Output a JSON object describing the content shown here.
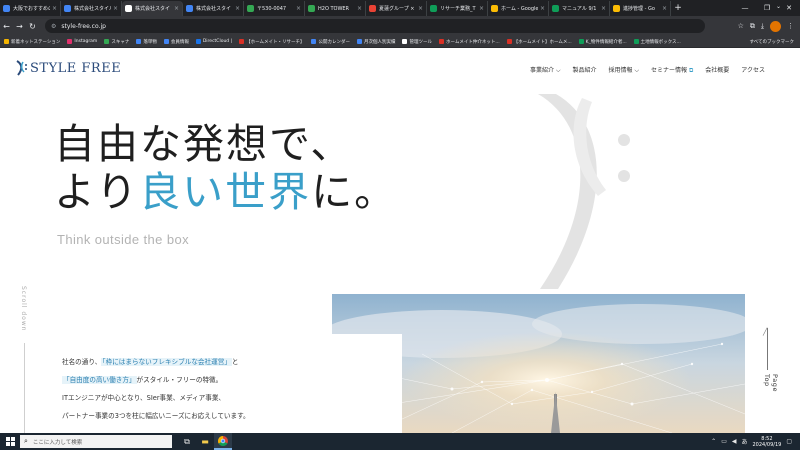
{
  "browser": {
    "tabs": [
      {
        "label": "大阪でおすすめの",
        "color": "#4285f4"
      },
      {
        "label": "株式会社スタイル",
        "color": "#4285f4"
      },
      {
        "label": "株式会社スタイ",
        "color": "#ffffff",
        "active": true
      },
      {
        "label": "株式会社スタイ",
        "color": "#4285f4"
      },
      {
        "label": "〒530-0047",
        "color": "#34a853"
      },
      {
        "label": "H2O TOWER",
        "color": "#34a853"
      },
      {
        "label": "夏蓮グループ ×",
        "color": "#ea4335"
      },
      {
        "label": "リサーチ業務_T",
        "color": "#0f9d58"
      },
      {
        "label": "ホーム - Google",
        "color": "#fbbc04"
      },
      {
        "label": "マニュアル 9/1",
        "color": "#0f9d58"
      },
      {
        "label": "進捗管理 - Go",
        "color": "#fbbc04"
      }
    ],
    "new_tab": "+",
    "url": "style-free.co.jp",
    "bookmarks": [
      {
        "label": "新着ネットステーション",
        "color": "#f4b400"
      },
      {
        "label": "Instagram",
        "color": "#e1306c"
      },
      {
        "label": "スキャナ",
        "color": "#34a853"
      },
      {
        "label": "落単物",
        "color": "#4285f4"
      },
      {
        "label": "会員情報",
        "color": "#4285f4"
      },
      {
        "label": "DirectCloud |",
        "color": "#1a73e8"
      },
      {
        "label": "【ホームメイト・リサーチ】",
        "color": "#d93025"
      },
      {
        "label": "公開カレンダー",
        "color": "#4285f4"
      },
      {
        "label": "月次個人別実績",
        "color": "#4285f4"
      },
      {
        "label": "管理ツール",
        "color": "#ffffff"
      },
      {
        "label": "ホームメイト仲介ネット...",
        "color": "#d93025"
      },
      {
        "label": "【ホームメイト】ホームメ...",
        "color": "#d93025"
      },
      {
        "label": "K_物件情報紹介者...",
        "color": "#0f9d58"
      },
      {
        "label": "土地情報ボックス...",
        "color": "#0f9d58"
      }
    ],
    "all_bookmarks": "すべてのブックマーク"
  },
  "site": {
    "logo_text": "STYLE FREE",
    "nav": [
      {
        "label": "事業紹介",
        "dropdown": true
      },
      {
        "label": "製品紹介",
        "dropdown": false
      },
      {
        "label": "採用情報",
        "dropdown": true
      },
      {
        "label": "セミナー情報",
        "dropdown": false
      },
      {
        "label": "会社概要",
        "dropdown": false
      },
      {
        "label": "アクセス",
        "dropdown": false
      }
    ],
    "hero": {
      "line1": "自由な発想で、",
      "line2_pre": "より",
      "line2_accent": "良い世界",
      "line2_post": "に。",
      "subcopy": "Think outside the box"
    },
    "scroll_down": "Scroll down",
    "body": {
      "p1_pre": "社名の通り、",
      "p1_hl": "「枠にはまらないフレキシブルな会社運営」",
      "p1_post": "と",
      "p2_hl": "「自由度の高い働き方」",
      "p2_post": "がスタイル・フリーの特徴。",
      "p3": "ITエンジニアが中心となり、SIer事業、メディア事業、",
      "p4": "パートナー事業の3つを柱に幅広いニーズにお応えしています。"
    },
    "page_top": "Page Top"
  },
  "taskbar": {
    "search_placeholder": "ここに入力して検索",
    "time": "8:52",
    "date": "2024/09/19"
  },
  "colors": {
    "accent": "#3a9fc9",
    "logo": "#2a4a7a",
    "taskbar": "#1b2631",
    "chrome_dark": "#202124"
  }
}
